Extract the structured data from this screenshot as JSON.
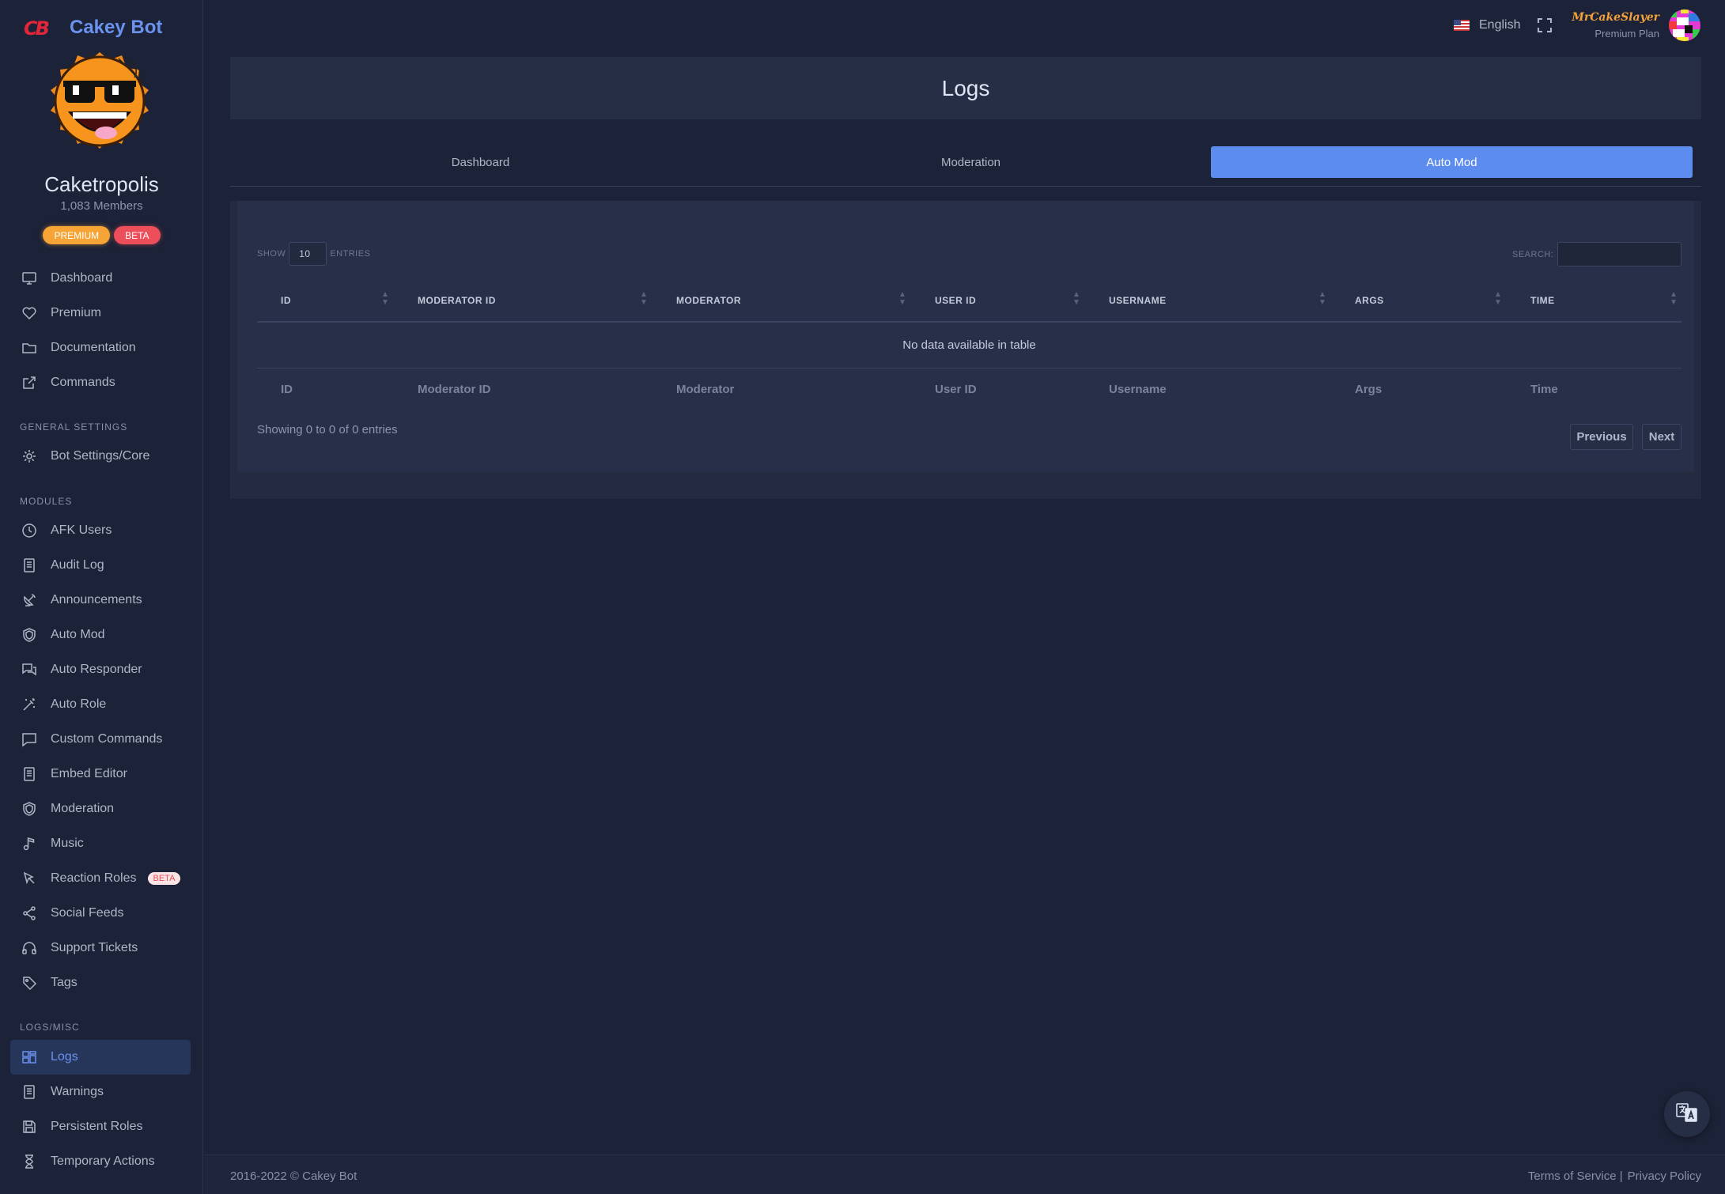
{
  "brand": {
    "logo_text": "CB",
    "name": "Cakey Bot"
  },
  "server": {
    "name": "Caketropolis",
    "members": "1,083 Members",
    "badges": {
      "premium": "PREMIUM",
      "beta": "BETA"
    }
  },
  "sidebar": {
    "top_items": [
      {
        "label": "Dashboard",
        "icon": "monitor-icon"
      },
      {
        "label": "Premium",
        "icon": "heart-icon"
      },
      {
        "label": "Documentation",
        "icon": "folder-icon"
      },
      {
        "label": "Commands",
        "icon": "external-link-icon"
      }
    ],
    "general_title": "GENERAL SETTINGS",
    "general_items": [
      {
        "label": "Bot Settings/Core",
        "icon": "gear-icon"
      }
    ],
    "modules_title": "MODULES",
    "module_items": [
      {
        "label": "AFK Users",
        "icon": "clock-icon"
      },
      {
        "label": "Audit Log",
        "icon": "document-icon"
      },
      {
        "label": "Announcements",
        "icon": "satellite-icon"
      },
      {
        "label": "Auto Mod",
        "icon": "shield-icon"
      },
      {
        "label": "Auto Responder",
        "icon": "chat-bubbles-icon"
      },
      {
        "label": "Auto Role",
        "icon": "magic-wand-icon"
      },
      {
        "label": "Custom Commands",
        "icon": "message-icon"
      },
      {
        "label": "Embed Editor",
        "icon": "document-icon"
      },
      {
        "label": "Moderation",
        "icon": "shield-icon"
      },
      {
        "label": "Music",
        "icon": "music-note-icon"
      },
      {
        "label": "Reaction Roles",
        "icon": "pointer-icon",
        "badge": "BETA"
      },
      {
        "label": "Social Feeds",
        "icon": "share-icon"
      },
      {
        "label": "Support Tickets",
        "icon": "headphones-icon"
      },
      {
        "label": "Tags",
        "icon": "tag-icon"
      }
    ],
    "logs_title": "LOGS/MISC",
    "log_items": [
      {
        "label": "Logs",
        "icon": "layout-icon",
        "active": true
      },
      {
        "label": "Warnings",
        "icon": "document-icon"
      },
      {
        "label": "Persistent Roles",
        "icon": "save-icon"
      },
      {
        "label": "Temporary Actions",
        "icon": "hourglass-icon"
      }
    ]
  },
  "topbar": {
    "language": "English",
    "user_name": "MrCakeSlayer",
    "user_plan": "Premium Plan"
  },
  "page": {
    "title": "Logs"
  },
  "tabs": [
    {
      "label": "Dashboard",
      "active": false
    },
    {
      "label": "Moderation",
      "active": false
    },
    {
      "label": "Auto Mod",
      "active": true
    }
  ],
  "table": {
    "show_label": "SHOW",
    "entries_value": "10",
    "entries_label": "ENTRIES",
    "search_label": "SEARCH:",
    "headers": [
      "ID",
      "MODERATOR ID",
      "MODERATOR",
      "USER ID",
      "USERNAME",
      "ARGS",
      "TIME"
    ],
    "footers": [
      "ID",
      "Moderator ID",
      "Moderator",
      "User ID",
      "Username",
      "Args",
      "Time"
    ],
    "empty_message": "No data available in table",
    "info": "Showing 0 to 0 of 0 entries",
    "prev_label": "Previous",
    "next_label": "Next"
  },
  "footer": {
    "copyright": "2016-2022 © Cakey Bot",
    "terms": "Terms of Service |",
    "privacy": "Privacy Policy"
  },
  "colors": {
    "accent": "#5c8ced",
    "brand": "#6c92ef",
    "premium": "#f6a435",
    "beta": "#ec4f5a",
    "background": "#1c2237"
  }
}
